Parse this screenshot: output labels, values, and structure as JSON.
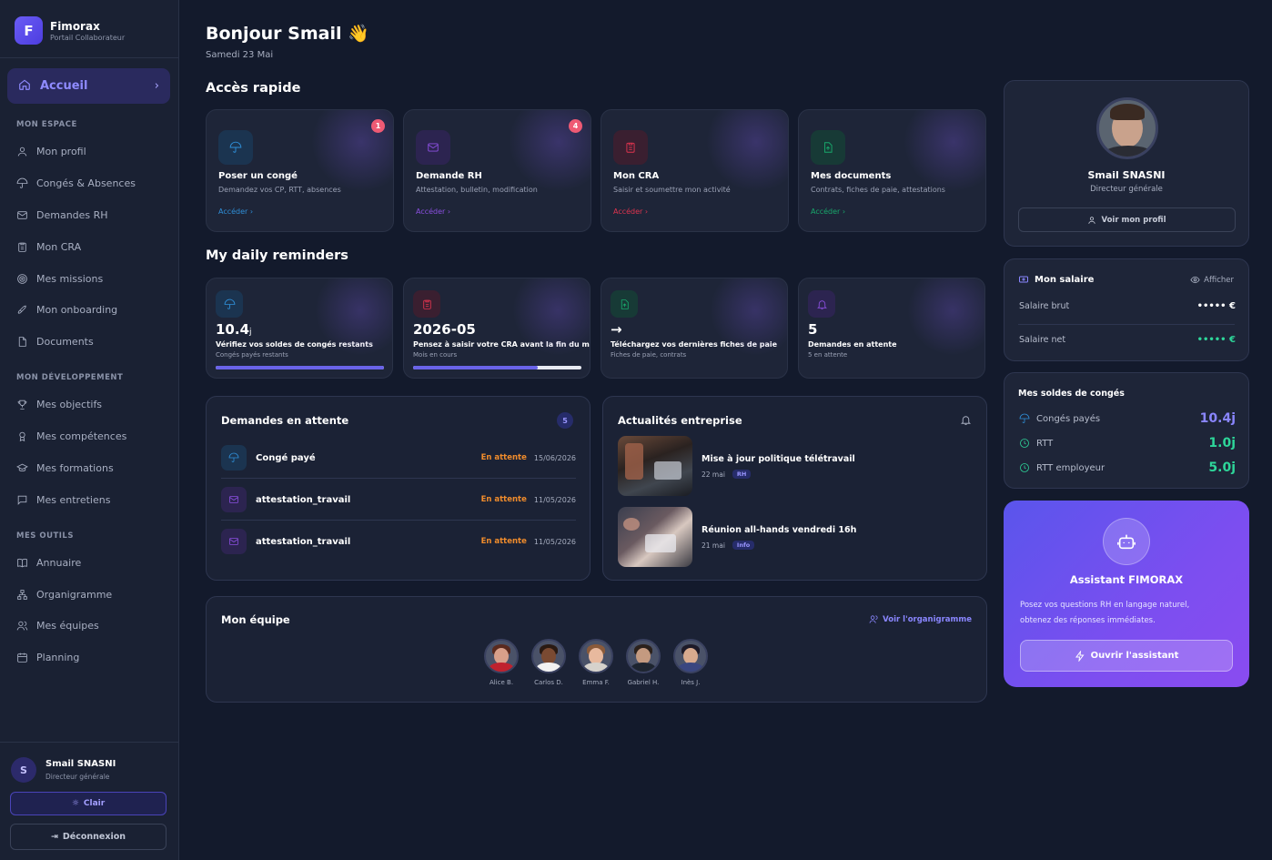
{
  "brand": {
    "name": "Fimorax",
    "subtitle": "Portail Collaborateur",
    "logo_letter": "F"
  },
  "nav": {
    "home": {
      "label": "Accueil",
      "icon": "home-icon"
    },
    "sections": [
      {
        "title": "MON ESPACE",
        "items": [
          {
            "label": "Mon profil",
            "icon": "user-icon"
          },
          {
            "label": "Congés & Absences",
            "icon": "umbrella-icon"
          },
          {
            "label": "Demandes RH",
            "icon": "mail-icon"
          },
          {
            "label": "Mon CRA",
            "icon": "clipboard-icon"
          },
          {
            "label": "Mes missions",
            "icon": "target-icon"
          },
          {
            "label": "Mon onboarding",
            "icon": "rocket-icon"
          },
          {
            "label": "Documents",
            "icon": "file-icon"
          }
        ]
      },
      {
        "title": "MON DÉVELOPPEMENT",
        "items": [
          {
            "label": "Mes objectifs",
            "icon": "trophy-icon"
          },
          {
            "label": "Mes compétences",
            "icon": "award-icon"
          },
          {
            "label": "Mes formations",
            "icon": "graduation-icon"
          },
          {
            "label": "Mes entretiens",
            "icon": "chat-icon"
          }
        ]
      },
      {
        "title": "MES OUTILS",
        "items": [
          {
            "label": "Annuaire",
            "icon": "book-icon"
          },
          {
            "label": "Organigramme",
            "icon": "org-icon"
          },
          {
            "label": "Mes équipes",
            "icon": "users-icon"
          },
          {
            "label": "Planning",
            "icon": "calendar-icon"
          }
        ]
      }
    ]
  },
  "user": {
    "initial": "S",
    "name": "Smail SNASNI",
    "role": "Directeur générale",
    "theme_label": "Clair",
    "logout_label": "Déconnexion"
  },
  "header": {
    "greeting": "Bonjour Smail 👋",
    "date": "Samedi 23 Mai"
  },
  "quick_access": {
    "title": "Accès rapide",
    "cards": [
      {
        "title": "Poser un congé",
        "desc": "Demandez vos CP, RTT, absences",
        "link": "Accéder",
        "badge": "1",
        "color": "#2f8fd8"
      },
      {
        "title": "Demande RH",
        "desc": "Attestation, bulletin, modification",
        "link": "Accéder",
        "badge": "4",
        "color": "#8b4fe0"
      },
      {
        "title": "Mon CRA",
        "desc": "Saisir et soumettre mon activité",
        "link": "Accéder",
        "badge": "",
        "color": "#e0344f"
      },
      {
        "title": "Mes documents",
        "desc": "Contrats, fiches de paie, attestations",
        "link": "Accéder",
        "badge": "",
        "color": "#18a86b"
      }
    ]
  },
  "reminders": {
    "title": "My daily reminders",
    "cards": [
      {
        "value": "10.4",
        "unit": "j",
        "label": "Vérifiez vos soldes de congés restants",
        "sub": "Congés payés restants",
        "progress": 1.0,
        "color": "#2f8fd8"
      },
      {
        "value": "2026-05",
        "unit": "",
        "label": "Pensez à saisir votre CRA avant la fin du mois",
        "sub": "Mois en cours",
        "progress": 0.74,
        "color": "#e0344f"
      },
      {
        "value": "→",
        "unit": "",
        "label": "Téléchargez vos dernières fiches de paie",
        "sub": "Fiches de paie, contrats",
        "progress": null,
        "color": "#18a86b"
      },
      {
        "value": "5",
        "unit": "",
        "label": "Demandes en attente",
        "sub": "5 en attente",
        "progress": null,
        "color": "#8b4fe0"
      }
    ]
  },
  "pending": {
    "title": "Demandes en attente",
    "count": "5",
    "rows": [
      {
        "name": "Congé payé",
        "status": "En attente",
        "date": "15/06/2026",
        "color": "#2f8fd8"
      },
      {
        "name": "attestation_travail",
        "status": "En attente",
        "date": "11/05/2026",
        "color": "#8b4fe0"
      },
      {
        "name": "attestation_travail",
        "status": "En attente",
        "date": "11/05/2026",
        "color": "#8b4fe0"
      }
    ]
  },
  "news": {
    "title": "Actualités entreprise",
    "items": [
      {
        "title": "Mise à jour politique télétravail",
        "date": "22 mai",
        "tag": "RH"
      },
      {
        "title": "Réunion all-hands vendredi 16h",
        "date": "21 mai",
        "tag": "Info"
      }
    ]
  },
  "team": {
    "title": "Mon équipe",
    "link": "Voir l'organigramme",
    "members": [
      {
        "name": "Alice B.",
        "skin": "#d9a08a",
        "hair": "#5a2a1e",
        "shirt": "#c0222e"
      },
      {
        "name": "Carlos D.",
        "skin": "#7a4a32",
        "hair": "#2a1a12",
        "shirt": "#f2f2f2"
      },
      {
        "name": "Emma F.",
        "skin": "#e8b99e",
        "hair": "#8a5a3a",
        "shirt": "#d6d2cc"
      },
      {
        "name": "Gabriel H.",
        "skin": "#c49a80",
        "hair": "#2b211c",
        "shirt": "#1e2530"
      },
      {
        "name": "Inès J.",
        "skin": "#d8aa8e",
        "hair": "#1e1a28",
        "shirt": "#3a4680"
      }
    ]
  },
  "profile": {
    "name": "Smail SNASNI",
    "role": "Directeur générale",
    "button": "Voir mon profil"
  },
  "salary": {
    "title": "Mon salaire",
    "toggle": "Afficher",
    "rows": [
      {
        "label": "Salaire brut",
        "value": "••••• €",
        "color": "#ffffff"
      },
      {
        "label": "Salaire net",
        "value": "••••• €",
        "color": "#2ed69a"
      }
    ]
  },
  "balances": {
    "title": "Mes soldes de congés",
    "rows": [
      {
        "label": "Congés payés",
        "value": "10.4j",
        "color": "#8a86ff",
        "icon": "umbrella-icon"
      },
      {
        "label": "RTT",
        "value": "1.0j",
        "color": "#2ed69a",
        "icon": "clock-icon"
      },
      {
        "label": "RTT employeur",
        "value": "5.0j",
        "color": "#2ed69a",
        "icon": "clock-icon"
      }
    ]
  },
  "assistant": {
    "title": "Assistant FIMORAX",
    "desc_line1": "Posez vos questions RH en langage naturel,",
    "desc_line2": "obtenez des réponses immédiates.",
    "button": "Ouvrir l'assistant"
  }
}
